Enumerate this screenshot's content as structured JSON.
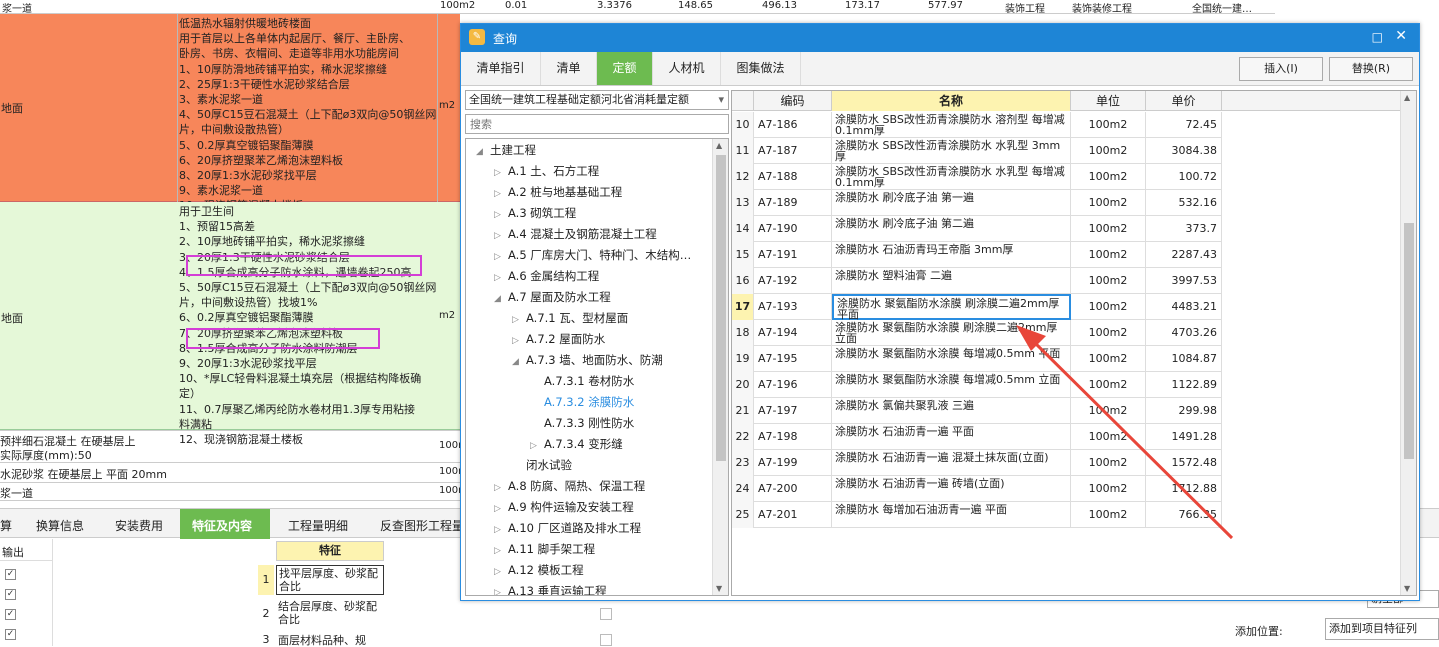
{
  "top_row": {
    "c1": "浆一道",
    "c2": "100m2",
    "c3": "0.01",
    "c4": "3.3376",
    "c5": "148.65",
    "c6": "496.13",
    "c7": "173.17",
    "c8": "577.97",
    "c9": "装饰工程",
    "c10": "装饰装修工程",
    "c11": "全国统一建…"
  },
  "row_orange": {
    "label": "地面",
    "unit": "m2",
    "lines": [
      "低温热水辐射供暖地砖楼面",
      "用于首层以上各单体内起居厅、餐厅、主卧房、",
      "卧房、书房、衣帽间、走道等非用水功能房间",
      "1、10厚防滑地砖铺平拍实，稀水泥浆擦缝",
      "2、25厚1:3干硬性水泥砂浆结合层",
      "3、素水泥浆一道",
      "4、50厚C15豆石混凝土（上下配ø3双向@50钢丝网",
      "片，中间敷设散热管）",
      "5、0.2厚真空镀铝聚酯薄膜",
      "6、20厚挤塑聚苯乙烯泡沫塑料板",
      "8、20厚1:3水泥砂浆找平层",
      "9、素水泥浆一道",
      "10、现浇钢筋混凝土楼板"
    ]
  },
  "row_green": {
    "label": "地面",
    "unit": "m2",
    "lines": [
      "用于卫生间",
      "1、预留15高差",
      "2、10厚地砖铺平拍实，稀水泥浆擦缝",
      "3、20厚1:3干硬性水泥砂浆结合层",
      "4、1.5厚合成高分子防水涂料，遇墙卷起250高",
      "5、50厚C15豆石混凝土（上下配ø3双向@50钢丝网",
      "片，中间敷设热管）找坡1%",
      "6、0.2厚真空镀铝聚酯薄膜",
      "7、20厚挤塑聚苯乙烯泡沫塑料板",
      "8、1.5厚合成高分子防水涂料防潮层",
      "9、20厚1:3水泥砂浆找平层",
      "10、*厚LC轻骨料混凝土填充层（根据结构降板确",
      "定）",
      "11、0.7厚聚乙烯丙纶防水卷材用1.3厚专用粘接",
      "料满粘",
      "12、现浇钢筋混凝土楼板"
    ]
  },
  "bottom_rows": {
    "r1a": "预拌细石混凝土 在硬基层上",
    "r1b": "实际厚度(mm):50",
    "r1u": "100m",
    "r2": "水泥砂浆 在硬基层上 平面 20mm",
    "r2u": "100m",
    "r3": "浆一道",
    "r3u": "100m"
  },
  "bottom_tabs": [
    "算",
    "换算信息",
    "安装费用",
    "特征及内容",
    "工程量明细",
    "反查图形工程量"
  ],
  "bottom_left": {
    "header": "输出"
  },
  "feature_table": {
    "header": "特征",
    "rows": [
      {
        "idx": "1",
        "text": "找平层厚度、砂浆配合比"
      },
      {
        "idx": "2",
        "text": "结合层厚度、砂浆配合比"
      },
      {
        "idx": "3",
        "text": "面层材料品种、规"
      }
    ]
  },
  "right_panel": {
    "add_position_label": "添加位置:",
    "add_position_value": "添加到项目特征列",
    "btn_partial": "剔全部"
  },
  "dialog": {
    "title": "查询",
    "tabs": [
      "清单指引",
      "清单",
      "定额",
      "人材机",
      "图集做法"
    ],
    "active_tab": "定额",
    "insert_btn": "插入(I)",
    "replace_btn": "替换(R)",
    "library": "全国统一建筑工程基础定额河北省消耗量定额",
    "search_placeholder": "搜索",
    "tree": [
      {
        "level": 0,
        "label": "土建工程",
        "arrow": "◢"
      },
      {
        "level": 1,
        "label": "A.1 土、石方工程",
        "arrow": "▷"
      },
      {
        "level": 1,
        "label": "A.2 桩与地基基础工程",
        "arrow": "▷"
      },
      {
        "level": 1,
        "label": "A.3 砌筑工程",
        "arrow": "▷"
      },
      {
        "level": 1,
        "label": "A.4 混凝土及钢筋混凝土工程",
        "arrow": "▷"
      },
      {
        "level": 1,
        "label": "A.5 厂库房大门、特种门、木结构…",
        "arrow": "▷"
      },
      {
        "level": 1,
        "label": "A.6 金属结构工程",
        "arrow": "▷"
      },
      {
        "level": 1,
        "label": "A.7 屋面及防水工程",
        "arrow": "◢"
      },
      {
        "level": 2,
        "label": "A.7.1 瓦、型材屋面",
        "arrow": "▷"
      },
      {
        "level": 2,
        "label": "A.7.2 屋面防水",
        "arrow": "▷"
      },
      {
        "level": 2,
        "label": "A.7.3 墙、地面防水、防潮",
        "arrow": "◢"
      },
      {
        "level": 3,
        "label": "A.7.3.1 卷材防水",
        "arrow": ""
      },
      {
        "level": 3,
        "label": "A.7.3.2 涂膜防水",
        "arrow": "",
        "selected": true
      },
      {
        "level": 3,
        "label": "A.7.3.3 刚性防水",
        "arrow": ""
      },
      {
        "level": 3,
        "label": "A.7.3.4 变形缝",
        "arrow": "▷"
      },
      {
        "level": 2,
        "label": "闭水试验",
        "arrow": ""
      },
      {
        "level": 1,
        "label": "A.8 防腐、隔热、保温工程",
        "arrow": "▷"
      },
      {
        "level": 1,
        "label": "A.9 构件运输及安装工程",
        "arrow": "▷"
      },
      {
        "level": 1,
        "label": "A.10 厂区道路及排水工程",
        "arrow": "▷"
      },
      {
        "level": 1,
        "label": "A.11 脚手架工程",
        "arrow": "▷"
      },
      {
        "level": 1,
        "label": "A.12 模板工程",
        "arrow": "▷"
      },
      {
        "level": 1,
        "label": "A.13 垂直运输工程",
        "arrow": "▷"
      }
    ],
    "grid_headers": [
      "编码",
      "名称",
      "单位",
      "单价"
    ],
    "rows": [
      {
        "idx": "10",
        "code": "A7-186",
        "name": "涂膜防水 SBS改性沥青涂膜防水 溶剂型 每增减0.1mm厚",
        "unit": "100m2",
        "price": "72.45"
      },
      {
        "idx": "11",
        "code": "A7-187",
        "name": "涂膜防水 SBS改性沥青涂膜防水 水乳型 3mm厚",
        "unit": "100m2",
        "price": "3084.38"
      },
      {
        "idx": "12",
        "code": "A7-188",
        "name": "涂膜防水 SBS改性沥青涂膜防水 水乳型 每增减0.1mm厚",
        "unit": "100m2",
        "price": "100.72"
      },
      {
        "idx": "13",
        "code": "A7-189",
        "name": "涂膜防水 刷冷底子油 第一遍",
        "unit": "100m2",
        "price": "532.16"
      },
      {
        "idx": "14",
        "code": "A7-190",
        "name": "涂膜防水 刷冷底子油 第二遍",
        "unit": "100m2",
        "price": "373.7"
      },
      {
        "idx": "15",
        "code": "A7-191",
        "name": "涂膜防水 石油沥青玛王帝脂 3mm厚",
        "unit": "100m2",
        "price": "2287.43"
      },
      {
        "idx": "16",
        "code": "A7-192",
        "name": "涂膜防水 塑料油膏 二遍",
        "unit": "100m2",
        "price": "3997.53"
      },
      {
        "idx": "17",
        "code": "A7-193",
        "name": "涂膜防水 聚氨酯防水涂膜 刷涂膜二遍2mm厚 平面",
        "unit": "100m2",
        "price": "4483.21",
        "selected": true
      },
      {
        "idx": "18",
        "code": "A7-194",
        "name": "涂膜防水 聚氨酯防水涂膜 刷涂膜二遍2mm厚 立面",
        "unit": "100m2",
        "price": "4703.26"
      },
      {
        "idx": "19",
        "code": "A7-195",
        "name": "涂膜防水 聚氨酯防水涂膜 每增减0.5mm 平面",
        "unit": "100m2",
        "price": "1084.87"
      },
      {
        "idx": "20",
        "code": "A7-196",
        "name": "涂膜防水 聚氨酯防水涂膜 每增减0.5mm 立面",
        "unit": "100m2",
        "price": "1122.89"
      },
      {
        "idx": "21",
        "code": "A7-197",
        "name": "涂膜防水 氯偏共聚乳液 三遍",
        "unit": "100m2",
        "price": "299.98"
      },
      {
        "idx": "22",
        "code": "A7-198",
        "name": "涂膜防水 石油沥青一遍 平面",
        "unit": "100m2",
        "price": "1491.28"
      },
      {
        "idx": "23",
        "code": "A7-199",
        "name": "涂膜防水 石油沥青一遍 混凝土抹灰面(立面)",
        "unit": "100m2",
        "price": "1572.48"
      },
      {
        "idx": "24",
        "code": "A7-200",
        "name": "涂膜防水 石油沥青一遍 砖墙(立面)",
        "unit": "100m2",
        "price": "1712.88"
      },
      {
        "idx": "25",
        "code": "A7-201",
        "name": "涂膜防水 每增加石油沥青一遍 平面",
        "unit": "100m2",
        "price": "766.35"
      }
    ]
  },
  "colors": {
    "accent_green": "#6dbb50",
    "title_blue": "#1e85d6",
    "orange_row": "#f7865a",
    "green_row": "#e5f8d8",
    "highlight": "#d43ed6",
    "arrow": "#e8463a"
  }
}
